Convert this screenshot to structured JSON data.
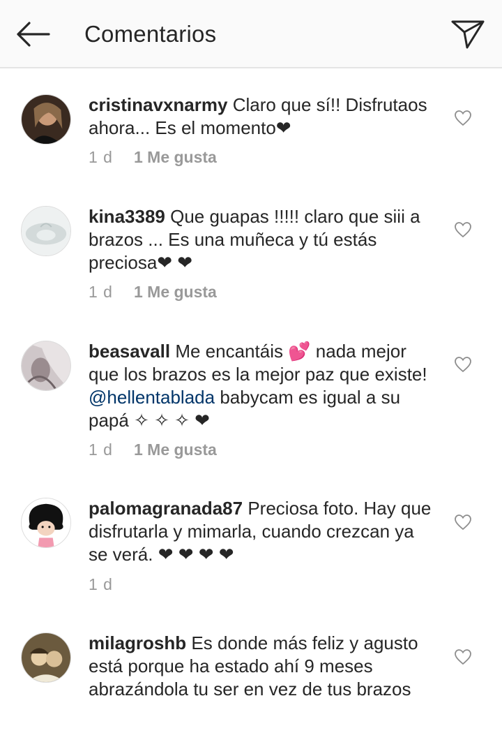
{
  "header": {
    "title": "Comentarios",
    "back_icon": "arrow-left-icon",
    "send_icon": "direct-send-icon"
  },
  "comments": [
    {
      "username": "cristinavxnarmy",
      "text": "Claro que sí!! Disfrutaos ahora... Es el momento❤",
      "time": "1 d",
      "likes": "1 Me gusta"
    },
    {
      "username": "kina3389",
      "text": "Que guapas !!!!! claro que siii a brazos ... Es una muñeca y tú estás preciosa❤ ❤",
      "time": "1 d",
      "likes": "1 Me gusta"
    },
    {
      "username": "beasavall",
      "text_before": "Me encantáis 💕 nada mejor que los brazos es la mejor paz que existe! ",
      "mention": "@hellentablada",
      "text_after": " babycam es igual a su papá ✧ ✧ ✧ ❤",
      "time": "1 d",
      "likes": "1 Me gusta"
    },
    {
      "username": "palomagranada87",
      "text": "Preciosa foto. Hay que disfrutarla y mimarla, cuando crezcan ya se verá. ❤ ❤ ❤ ❤",
      "time": "1 d"
    },
    {
      "username": "milagroshb",
      "text": "Es donde más feliz y agusto está porque ha estado ahí 9 meses abrazándola tu ser en vez de tus brazos"
    }
  ]
}
